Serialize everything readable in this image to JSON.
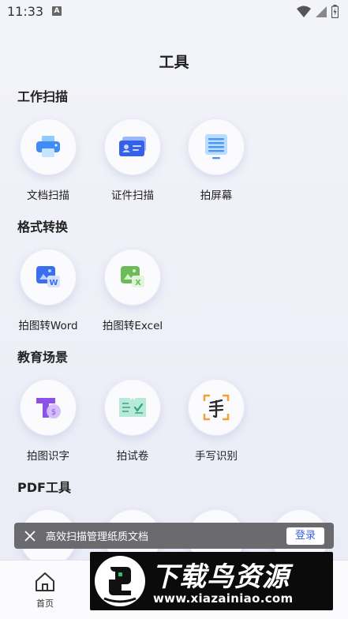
{
  "status_bar": {
    "time": "11:33",
    "notice": "A"
  },
  "page_title": "工具",
  "sections": [
    {
      "title": "工作扫描",
      "tools": [
        {
          "label": "文档扫描",
          "icon": "printer-icon"
        },
        {
          "label": "证件扫描",
          "icon": "id-card-icon"
        },
        {
          "label": "拍屏幕",
          "icon": "screen-icon"
        }
      ]
    },
    {
      "title": "格式转换",
      "tools": [
        {
          "label": "拍图转Word",
          "icon": "word-icon"
        },
        {
          "label": "拍图转Excel",
          "icon": "excel-icon"
        }
      ]
    },
    {
      "title": "教育场景",
      "tools": [
        {
          "label": "拍图识字",
          "icon": "text-recognition-icon"
        },
        {
          "label": "拍试卷",
          "icon": "exam-paper-icon"
        },
        {
          "label": "手写识别",
          "icon": "handwriting-icon"
        }
      ]
    },
    {
      "title": "PDF工具",
      "tools": []
    }
  ],
  "banner": {
    "text": "高效扫描管理纸质文档",
    "login_label": "登录"
  },
  "tabbar": {
    "home_label": "首页"
  },
  "watermark": {
    "title": "下载鸟资源",
    "url": "www.xiazainiao.com"
  },
  "colors": {
    "accent": "#3a63e0",
    "banner_bg": "#6b6b6f"
  }
}
